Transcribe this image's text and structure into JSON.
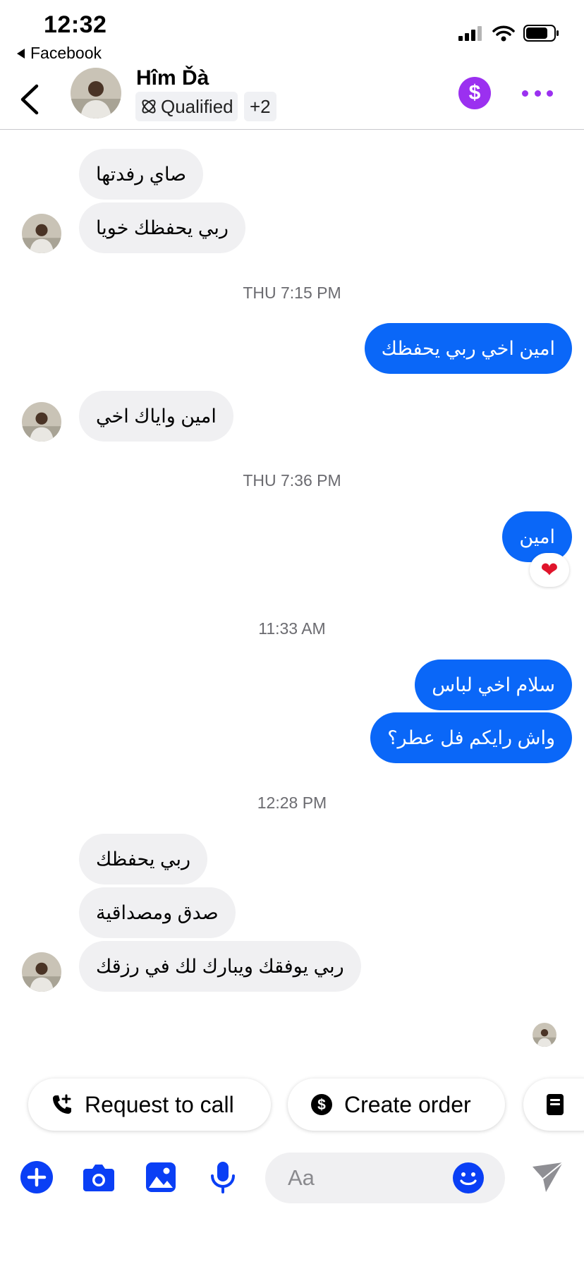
{
  "status_bar": {
    "time": "12:32",
    "back_app": "Facebook"
  },
  "header": {
    "contact_name": "Hîm Ďà",
    "badge_label": "Qualified",
    "extra_count": "+2",
    "payment_icon": "dollar-icon",
    "menu_icon": "more-icon"
  },
  "messages": [
    {
      "text": "صاي رفدتها"
    },
    {
      "text": "ربي يحفظك خويا"
    },
    {
      "timestamp": "THU 7:15 PM"
    },
    {
      "text": "امين اخي ربي يحفظك"
    },
    {
      "text": "امين واياك اخي"
    },
    {
      "timestamp": "THU 7:36 PM"
    },
    {
      "text": "امين",
      "reaction": "❤"
    },
    {
      "timestamp": "11:33 AM"
    },
    {
      "text": "سلام اخي لباس"
    },
    {
      "text": "واش رايكم فل عطر؟"
    },
    {
      "timestamp": "12:28 PM"
    },
    {
      "text": "ربي يحفظك"
    },
    {
      "text": "صدق ومصداقية"
    },
    {
      "text": "ربي يوفقك ويبارك لك في رزقك"
    }
  ],
  "quick_actions": {
    "request_call": "Request to call",
    "create_order": "Create order"
  },
  "composer": {
    "placeholder": "Aa"
  },
  "colors": {
    "accent": "#0a67f8",
    "incoming_bubble": "#f0f0f2",
    "payment": "#9b30f0"
  }
}
